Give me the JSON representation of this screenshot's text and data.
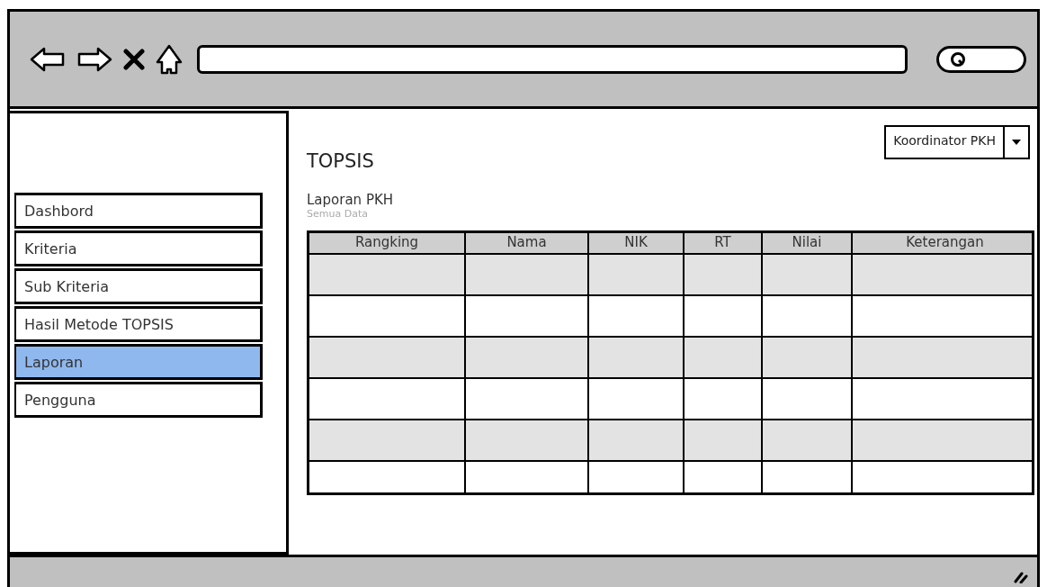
{
  "sidebar": {
    "items": [
      {
        "label": "Dashbord",
        "selected": false
      },
      {
        "label": "Kriteria",
        "selected": false
      },
      {
        "label": "Sub Kriteria",
        "selected": false
      },
      {
        "label": "Hasil Metode TOPSIS",
        "selected": false
      },
      {
        "label": "Laporan",
        "selected": true
      },
      {
        "label": "Pengguna",
        "selected": false
      }
    ]
  },
  "user_menu": {
    "value": "Koordinator PKH"
  },
  "page_title": "TOPSIS",
  "section": {
    "title": "Laporan PKH",
    "subtitle": "Semua Data"
  },
  "table": {
    "columns": [
      "Rangking",
      "Nama",
      "NIK",
      "RT",
      "Nilai",
      "Keterangan"
    ],
    "rows": [
      {
        "shaded": true
      },
      {
        "shaded": false
      },
      {
        "shaded": true
      },
      {
        "shaded": false
      },
      {
        "shaded": true
      },
      {
        "shaded": false
      }
    ]
  }
}
